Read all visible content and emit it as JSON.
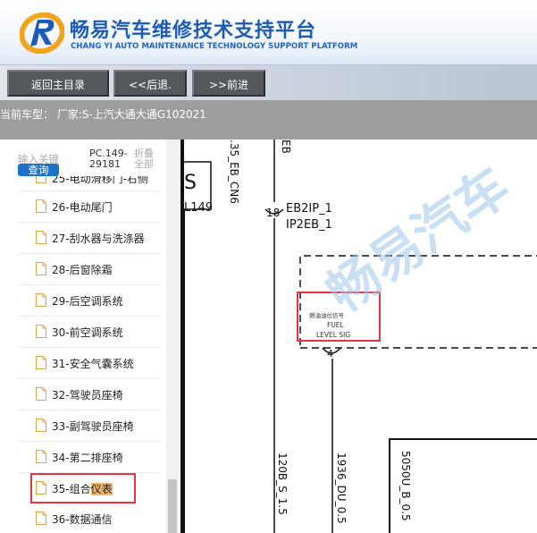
{
  "header": {
    "title_cn": "畅易汽车维修技术支持平台",
    "title_en": "CHANG YI AUTO MAINTENANCE TECHNOLOGY SUPPORT PLATFORM",
    "logo_icon": "ry-logo-icon"
  },
  "nav": {
    "home_label": "返回主目录",
    "back_label": "<<后退.",
    "forward_label": ">>前进"
  },
  "vehicle": {
    "text": "当前车型： 厂家:S-上汽大通大通G102021"
  },
  "sidebar": {
    "search_label": "输入关键",
    "search_button": "查询",
    "code": "PC.149-29181",
    "collapse_all": "折叠全部",
    "items": [
      {
        "label": "25-电动滑移门-右侧"
      },
      {
        "label": "26-电动尾门"
      },
      {
        "label": "27-刮水器与洗涤器"
      },
      {
        "label": "28-后窗除霜"
      },
      {
        "label": "29-后空调系统"
      },
      {
        "label": "30-前空调系统"
      },
      {
        "label": "31-安全气囊系统"
      },
      {
        "label": "32-驾驶员座椅"
      },
      {
        "label": "33-副驾驶员座椅"
      },
      {
        "label": "34-第二排座椅"
      },
      {
        "label": "35-组合",
        "highlight": "仪表"
      },
      {
        "label": "36-数据通信"
      }
    ]
  },
  "diagram": {
    "labels": {
      "l149": "L149",
      "eb_cn6": ".35_EB_CN6",
      "eb_top": "EB",
      "s_box": "S",
      "pin18": "18",
      "eb2ip": "EB2IP_1",
      "ip2eb": "IP2EB_1",
      "fuel_cn": "燃油油位信号",
      "fuel_en1": "FUEL",
      "fuel_en2": "LEVEL SIG",
      "pin4": "4",
      "w120b": "120B_S_1.5",
      "w1936": "1936_DU_0.5",
      "w5050": "5050U_B_0.5"
    },
    "watermark": "畅易汽车"
  },
  "colors": {
    "brand_blue": "#1c5cb8",
    "nav_button": "#54585d",
    "search_button": "#1d73c8",
    "selection_red": "#e83340",
    "highlight_orange": "#f7b56c",
    "vehicle_bar": "#9d9d9d"
  }
}
